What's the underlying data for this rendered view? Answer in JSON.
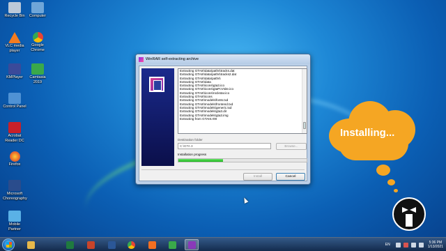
{
  "desktop": {
    "icons": [
      {
        "label": "Recycle Bin",
        "color": "#bcc9d8"
      },
      {
        "label": "Computer",
        "color": "#6fa6d8"
      },
      {
        "label": "VLC media player",
        "color": "#f47c20"
      },
      {
        "label": "Google Chrome",
        "color": "#e84335"
      },
      {
        "label": "KMPlayer",
        "color": "#3a4a9a"
      },
      {
        "label": "Camtasia 2019",
        "color": "#3aa94a"
      },
      {
        "label": "Control Panel",
        "color": "#4f92d4"
      },
      {
        "label": "Acrobat Reader DC",
        "color": "#c8202a"
      },
      {
        "label": "Firefox",
        "color": "#e8692a"
      },
      {
        "label": "Microsoft Choreography",
        "color": "#2a4c8c"
      },
      {
        "label": "Mobile Partner",
        "color": "#5ab1e6"
      }
    ]
  },
  "window": {
    "title": "WinRAR self-extracting archive",
    "log_lines": [
      "Extracting GTAIII\\data\\paths\\tracks.dat",
      "Extracting GTAIII\\data\\paths\\tracks2.dat",
      "Extracting GTAIII\\data\\paths\\",
      "Extracting GTAIII\\data",
      "Extracting GTAIII\\icons\\gta3.ico",
      "Extracting GTAIII\\icons\\gtaPcVsite.ico",
      "Extracting GTAIII\\icons\\rockstar.ico",
      "Extracting GTAIII\\icons",
      "Extracting GTAIII\\models\\fonts.txd",
      "Extracting GTAIII\\models\\frontend.txd",
      "Extracting GTAIII\\models\\generic.txd",
      "Extracting GTAIII\\models\\gta3.dir",
      "Extracting GTAIII\\models\\gta3.img",
      "Extracting from GTAIII.r09"
    ],
    "destination_label": "Destination folder",
    "destination_value": "C:\\GTA 3",
    "browse_label": "Browse...",
    "progress_label": "Installation progress",
    "progress_fraction": 0.35,
    "install_label": "Install",
    "cancel_label": "Cancel"
  },
  "callout": {
    "text": "Installing...",
    "color": "#f5a623"
  },
  "taskbar": {
    "apps": [
      {
        "name": "explorer",
        "color": "#e8b84a"
      },
      {
        "name": "excel",
        "color": "#1f7a3f"
      },
      {
        "name": "powerpoint",
        "color": "#c8442a"
      },
      {
        "name": "word",
        "color": "#2b5797"
      },
      {
        "name": "chrome",
        "color": "#e84335"
      },
      {
        "name": "camtasia",
        "color": "#f36f21"
      },
      {
        "name": "camtasia-recorder",
        "color": "#3aa94a"
      },
      {
        "name": "winrar",
        "color": "#8a3ab9"
      }
    ],
    "language": "EN",
    "time": "5:36 PM",
    "date": "1/13/2021"
  }
}
